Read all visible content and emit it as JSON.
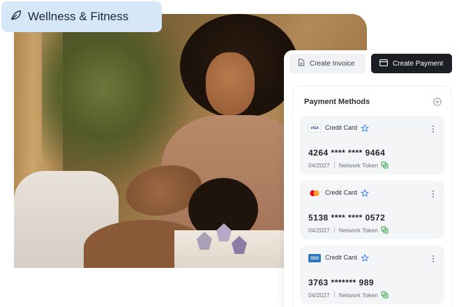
{
  "badge": {
    "label": "Wellness & Fitness",
    "icon": "leaf-icon"
  },
  "actions": {
    "create_invoice": "Create Invoice",
    "create_payment": "Create Payment"
  },
  "payment_methods": {
    "title": "Payment Methods",
    "cards": [
      {
        "brand": "visa",
        "logo_text": "VISA",
        "type": "Credit Card",
        "number": "4264 **** **** 9464",
        "expiry": "04/2027",
        "token": "Network Token"
      },
      {
        "brand": "mastercard",
        "type": "Credit Card",
        "number": "5138 **** **** 0572",
        "expiry": "04/2027",
        "token": "Network Token"
      },
      {
        "brand": "amex",
        "type": "Credit Card",
        "number": "3763 ******* 989",
        "expiry": "04/2027",
        "token": "Network Token"
      }
    ]
  },
  "colors": {
    "badge_bg": "#d6e8f7",
    "primary_button": "#1b1e22",
    "star": "#3b82f6",
    "token": "#2f9e44"
  }
}
